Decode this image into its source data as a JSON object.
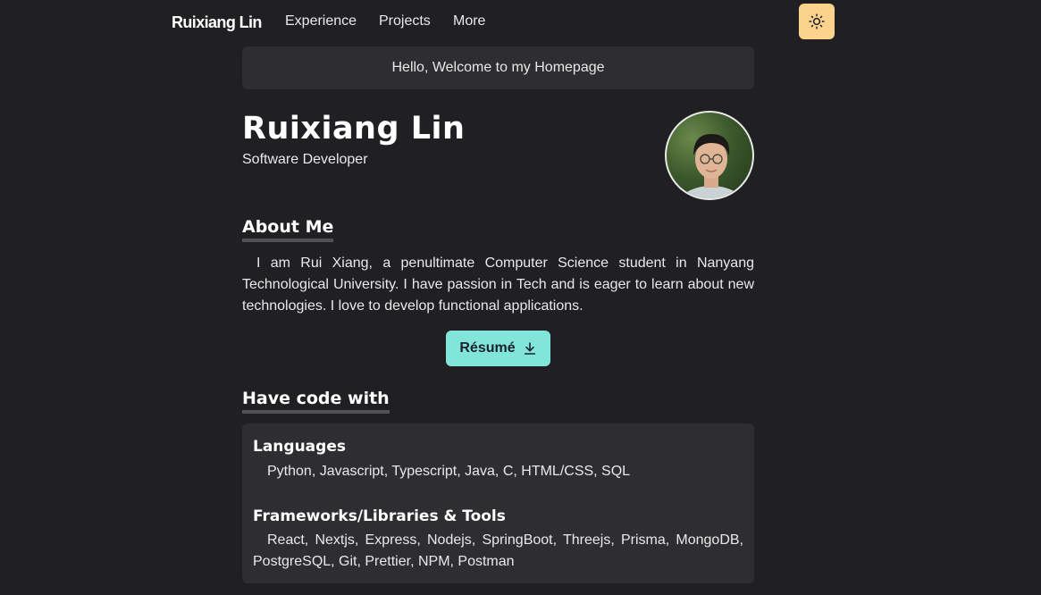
{
  "nav": {
    "brand": "Ruixiang Lin",
    "links": [
      "Experience",
      "Projects",
      "More"
    ],
    "theme_toggle_icon": "sun-icon"
  },
  "welcome": "Hello, Welcome to my Homepage",
  "profile": {
    "name": "Ruixiang Lin",
    "role": "Software Developer"
  },
  "about": {
    "heading": "About Me",
    "text": "I am Rui Xiang, a penultimate Computer Science student in Nanyang Technological University. I have passion in Tech and is eager to learn about new technologies. I love to develop functional applications."
  },
  "resume": {
    "label": "Résumé",
    "icon": "download-icon"
  },
  "skills": {
    "heading": "Have code with",
    "groups": [
      {
        "title": "Languages",
        "items": "Python, Javascript, Typescript, Java, C, HTML/CSS, SQL"
      },
      {
        "title": "Frameworks/Libraries & Tools",
        "items": "React, Nextjs, Express, Nodejs, SpringBoot, Threejs, Prisma, MongoDB, PostgreSQL, Git, Prettier, NPM, Postman"
      }
    ]
  },
  "colors": {
    "background": "#202023",
    "card": "#2e2e31",
    "accent_teal": "#81e6d9",
    "toggle_yellow": "#fbd38d"
  }
}
